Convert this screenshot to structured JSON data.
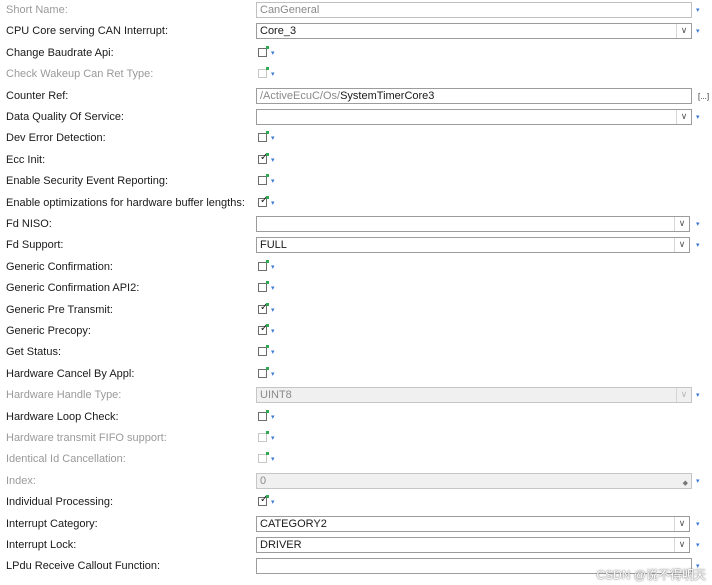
{
  "rows": [
    {
      "label": "Short Name:",
      "disabled": true,
      "kind": "text",
      "value": "CanGeneral",
      "readonly": true
    },
    {
      "label": "CPU Core serving CAN Interrupt:",
      "kind": "combo",
      "value": "Core_3"
    },
    {
      "label": "Change Baudrate Api:",
      "kind": "check",
      "checked": false
    },
    {
      "label": "Check Wakeup Can Ret Type:",
      "disabled": true,
      "kind": "check",
      "checked": false
    },
    {
      "label": "Counter Ref:",
      "kind": "ref",
      "value_prefix": "/ActiveEcuC/Os/",
      "value_tail": "SystemTimerCore3",
      "more": "[...]"
    },
    {
      "label": "Data Quality Of Service:",
      "kind": "combo",
      "value": ""
    },
    {
      "label": "Dev Error Detection:",
      "kind": "check",
      "checked": false
    },
    {
      "label": "Ecc Init:",
      "kind": "check",
      "checked": true
    },
    {
      "label": "Enable Security Event Reporting:",
      "kind": "check",
      "checked": false
    },
    {
      "label": "Enable optimizations for hardware buffer lengths:",
      "kind": "check",
      "checked": true
    },
    {
      "label": "Fd NISO:",
      "kind": "combo",
      "value": "",
      "narrow": true
    },
    {
      "label": "Fd Support:",
      "kind": "combo",
      "value": "FULL",
      "narrow": true
    },
    {
      "label": "Generic Confirmation:",
      "kind": "check",
      "checked": false
    },
    {
      "label": "Generic Confirmation API2:",
      "kind": "check",
      "checked": false
    },
    {
      "label": "Generic Pre Transmit:",
      "kind": "check",
      "checked": true
    },
    {
      "label": "Generic Precopy:",
      "kind": "check",
      "checked": true
    },
    {
      "label": "Get Status:",
      "kind": "check",
      "checked": false
    },
    {
      "label": "Hardware Cancel By Appl:",
      "kind": "check",
      "checked": false
    },
    {
      "label": "Hardware Handle Type:",
      "disabled": true,
      "kind": "combo",
      "value": "UINT8",
      "fieldDisabled": true
    },
    {
      "label": "Hardware Loop Check:",
      "kind": "check",
      "checked": false
    },
    {
      "label": "Hardware transmit FIFO support:",
      "disabled": true,
      "kind": "check",
      "checked": false
    },
    {
      "label": "Identical Id Cancellation:",
      "disabled": true,
      "kind": "check",
      "checked": false
    },
    {
      "label": "Index:",
      "disabled": true,
      "kind": "number",
      "value": "0"
    },
    {
      "label": "Individual Processing:",
      "kind": "check",
      "checked": true
    },
    {
      "label": "Interrupt Category:",
      "kind": "combo",
      "value": "CATEGORY2",
      "narrow": true
    },
    {
      "label": "Interrupt Lock:",
      "kind": "combo",
      "value": "DRIVER",
      "narrow": true
    },
    {
      "label": "LPdu Receive Callout Function:",
      "kind": "text",
      "value": ""
    }
  ],
  "watermark": "CSDN @说不得明天"
}
